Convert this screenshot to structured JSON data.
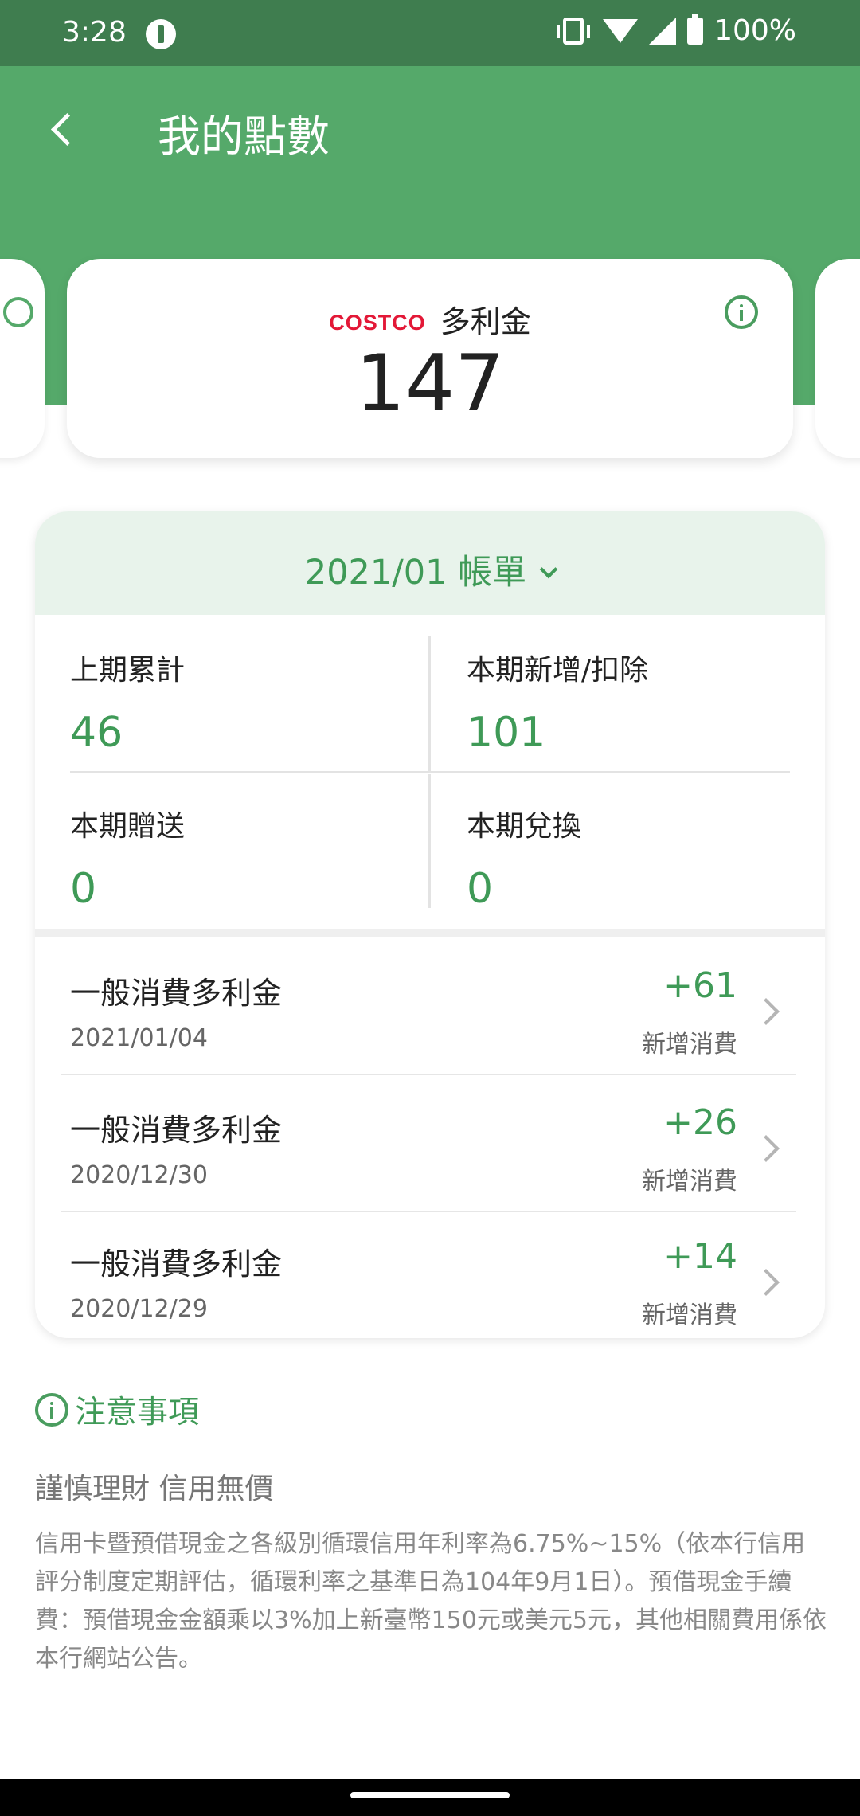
{
  "status_bar": {
    "time": "3:28",
    "battery": "100%"
  },
  "header": {
    "title": "我的點數"
  },
  "points_card": {
    "brand_logo": "COSTCO",
    "label": "多利金",
    "value": "147"
  },
  "statement": {
    "period_label": "2021/01 帳單",
    "stats": [
      {
        "label": "上期累計",
        "value": "46"
      },
      {
        "label": "本期新增/扣除",
        "value": "101"
      },
      {
        "label": "本期贈送",
        "value": "0"
      },
      {
        "label": "本期兌換",
        "value": "0"
      }
    ],
    "transactions": [
      {
        "title": "一般消費多利金",
        "date": "2021/01/04",
        "amount": "+61",
        "type": "新增消費"
      },
      {
        "title": "一般消費多利金",
        "date": "2020/12/30",
        "amount": "+26",
        "type": "新增消費"
      },
      {
        "title": "一般消費多利金",
        "date": "2020/12/29",
        "amount": "+14",
        "type": "新增消費"
      }
    ]
  },
  "notes": {
    "title": "注意事項",
    "subtitle": "謹慎理財  信用無價",
    "body": "信用卡暨預借現金之各級別循環信用年利率為6.75%~15%（依本行信用評分制度定期評估，循環利率之基準日為104年9月1日）。預借現金手續費：預借現金金額乘以3%加上新臺幣150元或美元5元，其他相關費用係依本行網站公告。"
  },
  "colors": {
    "status_bar": "#3f7d4f",
    "header": "#55a96a",
    "accent_green": "#3f9a57",
    "panel_head": "#e8f3eb",
    "brand_red": "#e31837"
  },
  "icons": [
    "back-icon",
    "info-icon",
    "chevron-down-icon",
    "chevron-right-icon",
    "vibrate-icon",
    "wifi-icon",
    "signal-icon",
    "battery-icon"
  ]
}
